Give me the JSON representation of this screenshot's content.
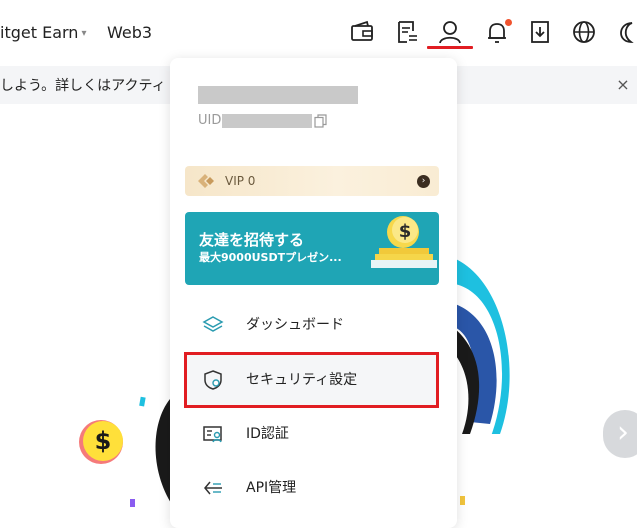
{
  "header": {
    "nav": [
      {
        "label": "itget Earn",
        "has_caret": true
      },
      {
        "label": "Web3",
        "has_caret": false
      }
    ],
    "caret_glyph": "▾",
    "icons": [
      "wallet-icon",
      "orders-icon",
      "user-icon",
      "bell-icon",
      "download-icon",
      "globe-icon",
      "moon-icon"
    ],
    "notification_dot_color": "#f0532e",
    "active_indicator_color": "#e11d22"
  },
  "notice": {
    "text": "しよう。詳しくはアクティ",
    "close": "×"
  },
  "dropdown": {
    "uid_label": "UID",
    "vip": {
      "label": "VIP 0",
      "arrow": "›"
    },
    "invite": {
      "title": "友達を招待する",
      "subtitle": "最大9000USDTプレゼン...",
      "color": "#1fa5b5"
    },
    "menu": [
      {
        "label": "ダッシュボード",
        "icon": "dashboard-layers-icon"
      },
      {
        "label": "セキュリティ設定",
        "icon": "shield-icon",
        "highlighted": true
      },
      {
        "label": "ID認証",
        "icon": "id-card-icon"
      },
      {
        "label": "API管理",
        "icon": "api-icon"
      }
    ],
    "highlight_color": "#e11d22"
  },
  "carousel": {
    "next": "›"
  }
}
